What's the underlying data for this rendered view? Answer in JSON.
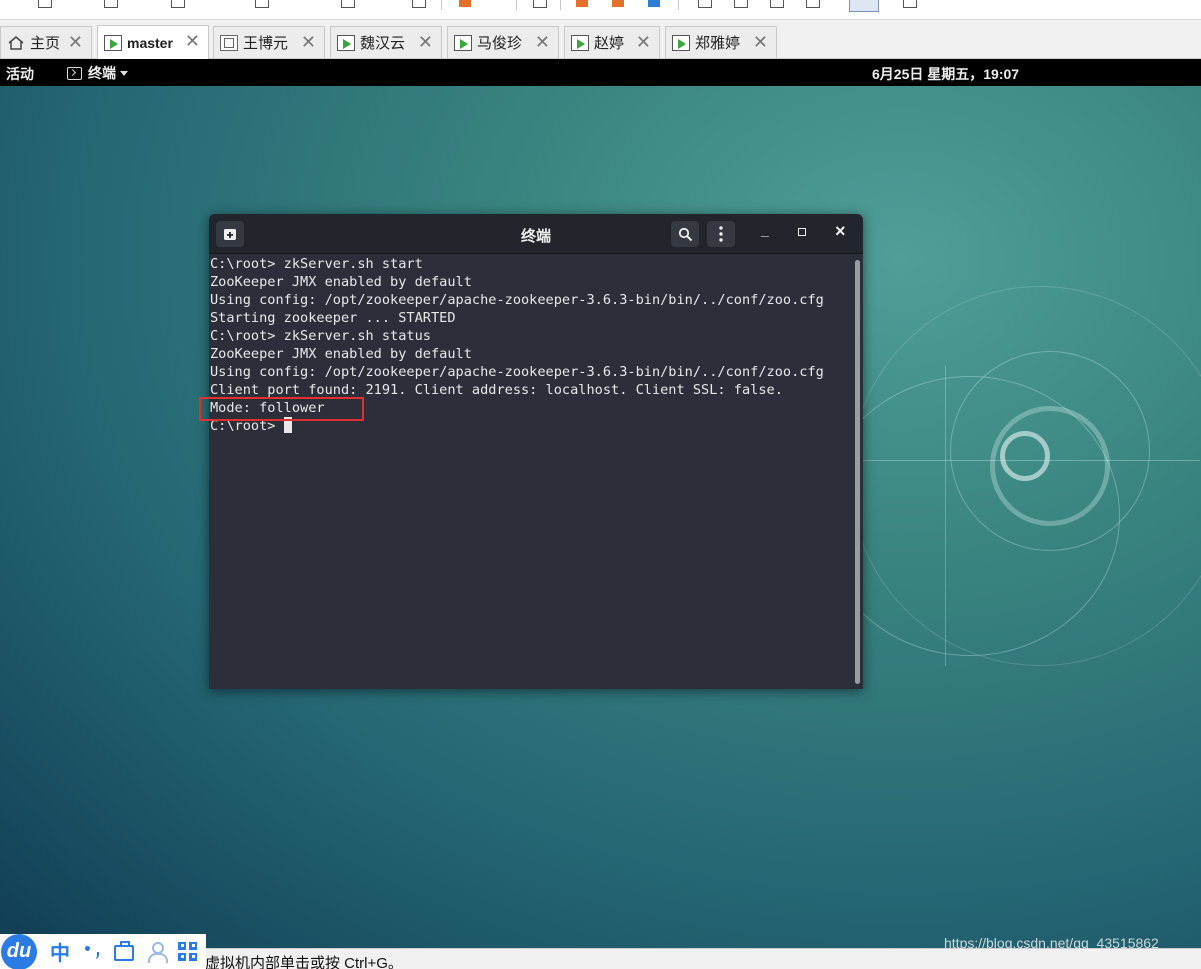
{
  "vmware": {
    "tabs": [
      {
        "label": "主页",
        "icon": "home-icon",
        "active": false
      },
      {
        "label": "master",
        "icon": "vm-running-icon",
        "active": true
      },
      {
        "label": "王博元",
        "icon": "vm-stopped-icon",
        "active": false
      },
      {
        "label": "魏汉云",
        "icon": "vm-running-icon",
        "active": false
      },
      {
        "label": "马俊珍",
        "icon": "vm-running-icon",
        "active": false
      },
      {
        "label": "赵婷",
        "icon": "vm-running-icon",
        "active": false
      },
      {
        "label": "郑雅婷",
        "icon": "vm-running-icon",
        "active": false
      }
    ],
    "close_glyph": "✕",
    "status_text": "虚拟机内部单击或按 Ctrl+G。"
  },
  "gnome": {
    "activities": "活动",
    "app_menu": "终端",
    "clock": "6月25日 星期五，19:07"
  },
  "terminal": {
    "title": "终端",
    "lines": [
      "C:\\root> zkServer.sh start",
      "ZooKeeper JMX enabled by default",
      "Using config: /opt/zookeeper/apache-zookeeper-3.6.3-bin/bin/../conf/zoo.cfg",
      "Starting zookeeper ... STARTED",
      "C:\\root> zkServer.sh status",
      "ZooKeeper JMX enabled by default",
      "Using config: /opt/zookeeper/apache-zookeeper-3.6.3-bin/bin/../conf/zoo.cfg",
      "Client port found: 2191. Client address: localhost. Client SSL: false.",
      "Mode: follower",
      "C:\\root> "
    ],
    "buttons": {
      "new_tab": "new-tab-icon",
      "search": "search-icon",
      "menu": "kebab-menu-icon",
      "minimize": "_",
      "maximize": "▫",
      "close": "×"
    }
  },
  "ime": {
    "logo": "du",
    "mode": "中"
  },
  "watermark": "https://blog.csdn.net/qq_43515862",
  "colors": {
    "highlight": "#e03131",
    "ime_blue": "#2a7be4",
    "terminal_bg": "#2c2f3a"
  }
}
